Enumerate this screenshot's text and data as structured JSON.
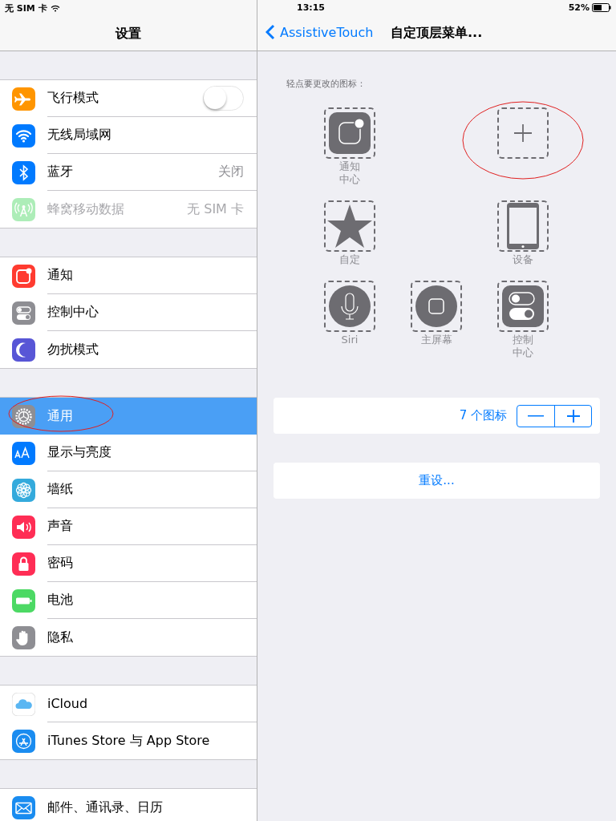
{
  "status_bar": {
    "carrier": "无 SIM 卡",
    "time": "13:15",
    "battery": "52%"
  },
  "sidebar": {
    "title": "设置",
    "groups": [
      [
        {
          "label": "飞行模式",
          "selected": false,
          "disabled": false,
          "switch": {
            "on": false
          }
        },
        {
          "label": "无线局域网",
          "selected": false,
          "disabled": false
        },
        {
          "label": "蓝牙",
          "value": "关闭",
          "selected": false,
          "disabled": false
        },
        {
          "label": "蜂窝移动数据",
          "value": "无 SIM 卡",
          "selected": false,
          "disabled": true
        }
      ],
      [
        {
          "label": "通知",
          "selected": false,
          "disabled": false
        },
        {
          "label": "控制中心",
          "selected": false,
          "disabled": false
        },
        {
          "label": "勿扰模式",
          "selected": false,
          "disabled": false
        }
      ],
      [
        {
          "label": "通用",
          "selected": true,
          "disabled": false
        },
        {
          "label": "显示与亮度",
          "selected": false,
          "disabled": false
        },
        {
          "label": "墙纸",
          "selected": false,
          "disabled": false
        },
        {
          "label": "声音",
          "selected": false,
          "disabled": false
        },
        {
          "label": "密码",
          "selected": false,
          "disabled": false
        },
        {
          "label": "电池",
          "selected": false,
          "disabled": false
        },
        {
          "label": "隐私",
          "selected": false,
          "disabled": false
        }
      ],
      [
        {
          "label": "iCloud",
          "selected": false,
          "disabled": false
        },
        {
          "label": "iTunes Store 与 App Store",
          "selected": false,
          "disabled": false
        }
      ],
      [
        {
          "label": "邮件、通讯录、日历",
          "selected": false,
          "disabled": false
        }
      ]
    ]
  },
  "detail": {
    "back": "AssistiveTouch",
    "title": "自定顶层菜单...",
    "prompt": "轻点要更改的图标：",
    "slots": [
      {
        "kind": "notification",
        "label": "通知中心"
      },
      {
        "kind": "empty"
      },
      {
        "kind": "add"
      },
      {
        "kind": "star",
        "label": "自定"
      },
      {
        "kind": "empty"
      },
      {
        "kind": "device",
        "label": "设备"
      },
      {
        "kind": "siri",
        "label": "Siri"
      },
      {
        "kind": "home",
        "label": "主屏幕"
      },
      {
        "kind": "control",
        "label": "控制中心"
      }
    ],
    "count": "7 个图标",
    "reset": "重设..."
  }
}
